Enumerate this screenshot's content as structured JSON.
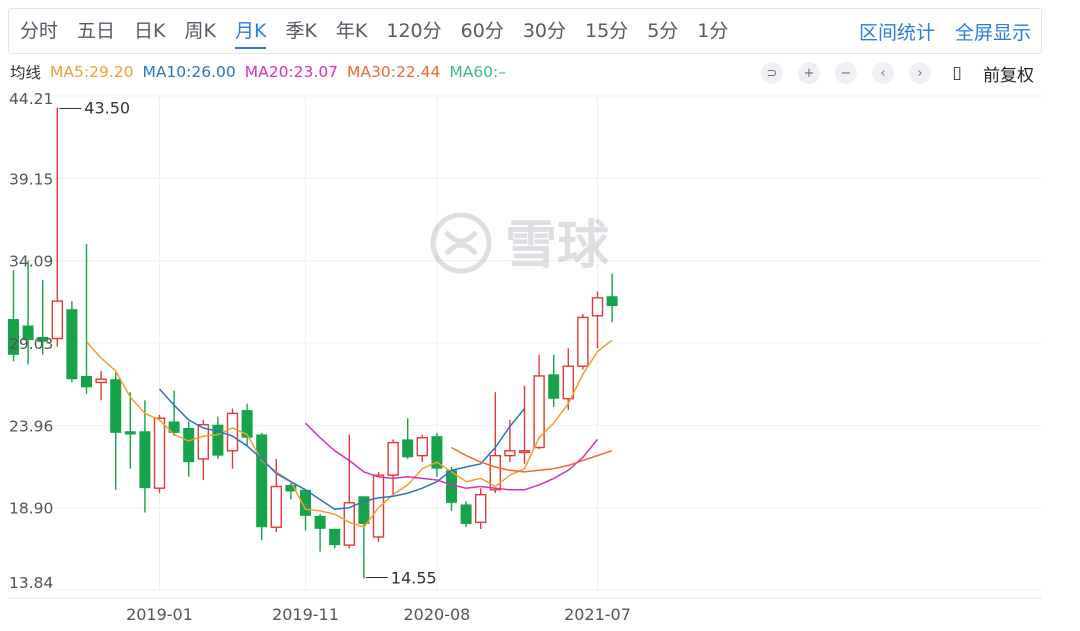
{
  "toolbar": {
    "tabs": [
      "分时",
      "五日",
      "日K",
      "周K",
      "月K",
      "季K",
      "年K",
      "120分",
      "60分",
      "30分",
      "15分",
      "5分",
      "1分"
    ],
    "active": "月K",
    "right_links": [
      "区间统计",
      "全屏显示"
    ]
  },
  "ma_legend": {
    "label": "均线",
    "items": [
      {
        "text": "MA5:29.20",
        "color": "#f0a030"
      },
      {
        "text": "MA10:26.00",
        "color": "#2c72c7"
      },
      {
        "text": "MA20:23.07",
        "color": "#d930b8"
      },
      {
        "text": "MA30:22.44",
        "color": "#ee6a2f"
      },
      {
        "text": "MA60:–",
        "color": "#3cbf7a"
      }
    ]
  },
  "controls": {
    "icons": [
      "undo-icon",
      "zoom-in-icon",
      "zoom-out-icon",
      "prev-icon",
      "next-icon",
      "candle-icon"
    ],
    "glyphs": [
      "⊃",
      "+",
      "−",
      "‹",
      "›",
      "▯"
    ],
    "fq_label": "前复权"
  },
  "watermark": "雪球",
  "chart_data": {
    "type": "candlestick",
    "title": "",
    "y_ticks": [
      44.21,
      39.15,
      34.09,
      29.03,
      23.96,
      18.9,
      13.84
    ],
    "ylim": [
      13.84,
      44.21
    ],
    "x_ticks": [
      {
        "label": "2019-01",
        "index": 10
      },
      {
        "label": "2019-11",
        "index": 20
      },
      {
        "label": "2020-08",
        "index": 29
      },
      {
        "label": "2021-07",
        "index": 40
      }
    ],
    "annotations": [
      {
        "text": "43.50",
        "index": 3,
        "value": 43.5
      },
      {
        "text": "14.55",
        "index": 24,
        "value": 14.55
      }
    ],
    "up_color": "#e53935",
    "down_color": "#16a34a",
    "candles": [
      [
        30.5,
        28.3,
        33.5,
        27.9
      ],
      [
        30.1,
        29.2,
        34.1,
        27.7
      ],
      [
        29.4,
        29.1,
        32.9,
        28.3
      ],
      [
        29.3,
        31.6,
        43.5,
        28.8
      ],
      [
        31.1,
        26.8,
        31.6,
        26.6
      ],
      [
        27.0,
        26.3,
        35.1,
        25.9
      ],
      [
        26.6,
        26.8,
        27.3,
        25.5
      ],
      [
        26.8,
        23.5,
        27.2,
        20.0
      ],
      [
        23.6,
        23.4,
        26.0,
        21.3
      ],
      [
        23.6,
        20.1,
        25.5,
        18.6
      ],
      [
        20.1,
        24.4,
        24.6,
        19.8
      ],
      [
        24.2,
        23.5,
        26.1,
        23.3
      ],
      [
        23.8,
        21.7,
        24.2,
        20.8
      ],
      [
        21.9,
        24.0,
        24.3,
        20.6
      ],
      [
        24.0,
        22.1,
        24.5,
        21.9
      ],
      [
        22.4,
        24.7,
        25.0,
        21.3
      ],
      [
        24.9,
        23.2,
        25.3,
        22.7
      ],
      [
        23.4,
        17.7,
        23.5,
        16.9
      ],
      [
        17.7,
        20.2,
        21.9,
        17.4
      ],
      [
        20.3,
        19.9,
        20.4,
        19.4
      ],
      [
        20.0,
        18.4,
        20.0,
        17.5
      ],
      [
        18.4,
        17.6,
        18.5,
        16.2
      ],
      [
        17.6,
        16.6,
        17.6,
        16.4
      ],
      [
        16.6,
        19.2,
        23.4,
        16.4
      ],
      [
        19.6,
        17.9,
        19.6,
        14.55
      ],
      [
        17.1,
        20.9,
        21.1,
        16.8
      ],
      [
        20.9,
        22.9,
        23.1,
        19.6
      ],
      [
        23.1,
        22.0,
        24.4,
        21.9
      ],
      [
        22.1,
        23.2,
        23.4,
        21.7
      ],
      [
        23.3,
        21.3,
        23.5,
        20.8
      ],
      [
        21.2,
        19.2,
        21.4,
        18.7
      ],
      [
        19.1,
        17.9,
        19.3,
        17.7
      ],
      [
        18.0,
        19.7,
        20.1,
        17.6
      ],
      [
        20.0,
        22.1,
        26.0,
        19.8
      ],
      [
        22.1,
        22.4,
        24.3,
        21.7
      ],
      [
        22.3,
        22.4,
        26.4,
        21.6
      ],
      [
        22.6,
        27.0,
        28.3,
        22.5
      ],
      [
        27.1,
        25.6,
        28.3,
        25.1
      ],
      [
        25.6,
        27.6,
        28.7,
        24.9
      ],
      [
        27.6,
        30.6,
        30.8,
        27.4
      ],
      [
        30.7,
        31.8,
        32.2,
        28.7
      ],
      [
        31.9,
        31.3,
        33.3,
        30.3
      ]
    ],
    "series": [
      {
        "name": "MA5",
        "color": "#f0a030",
        "start": 5,
        "values": [
          29.1,
          28.1,
          27.3,
          25.7,
          24.7,
          24.3,
          23.4,
          23.0,
          23.3,
          23.4,
          23.8,
          23.4,
          21.8,
          21.1,
          20.5,
          18.8,
          18.7,
          18.5,
          18.0,
          17.7,
          18.9,
          19.7,
          20.3,
          21.3,
          21.7,
          21.1,
          20.5,
          20.7,
          20.2,
          20.9,
          21.3,
          23.2,
          24.1,
          25.3,
          27.1,
          28.5,
          29.2
        ]
      },
      {
        "name": "MA10",
        "color": "#2c72c7",
        "start": 10,
        "values": [
          26.2,
          25.2,
          24.3,
          23.8,
          23.6,
          23.3,
          22.7,
          21.9,
          21.0,
          20.5,
          20.0,
          19.4,
          18.8,
          18.9,
          19.3,
          19.5,
          19.6,
          19.8,
          20.1,
          20.5,
          21.2,
          21.4,
          21.6,
          22.6,
          23.9,
          25.0
        ]
      },
      {
        "name": "MA20",
        "color": "#d930b8",
        "start": 20,
        "values": [
          24.1,
          23.2,
          22.4,
          21.8,
          21.1,
          20.8,
          20.7,
          20.8,
          20.7,
          20.6,
          20.3,
          20.1,
          20.2,
          20.1,
          20.0,
          20.0,
          20.3,
          20.7,
          21.2,
          22.0,
          23.1
        ]
      },
      {
        "name": "MA30",
        "color": "#ee6a2f",
        "start": 30,
        "values": [
          22.6,
          22.1,
          21.7,
          21.4,
          21.2,
          21.1,
          21.2,
          21.3,
          21.5,
          21.8,
          22.1,
          22.4
        ]
      }
    ]
  }
}
